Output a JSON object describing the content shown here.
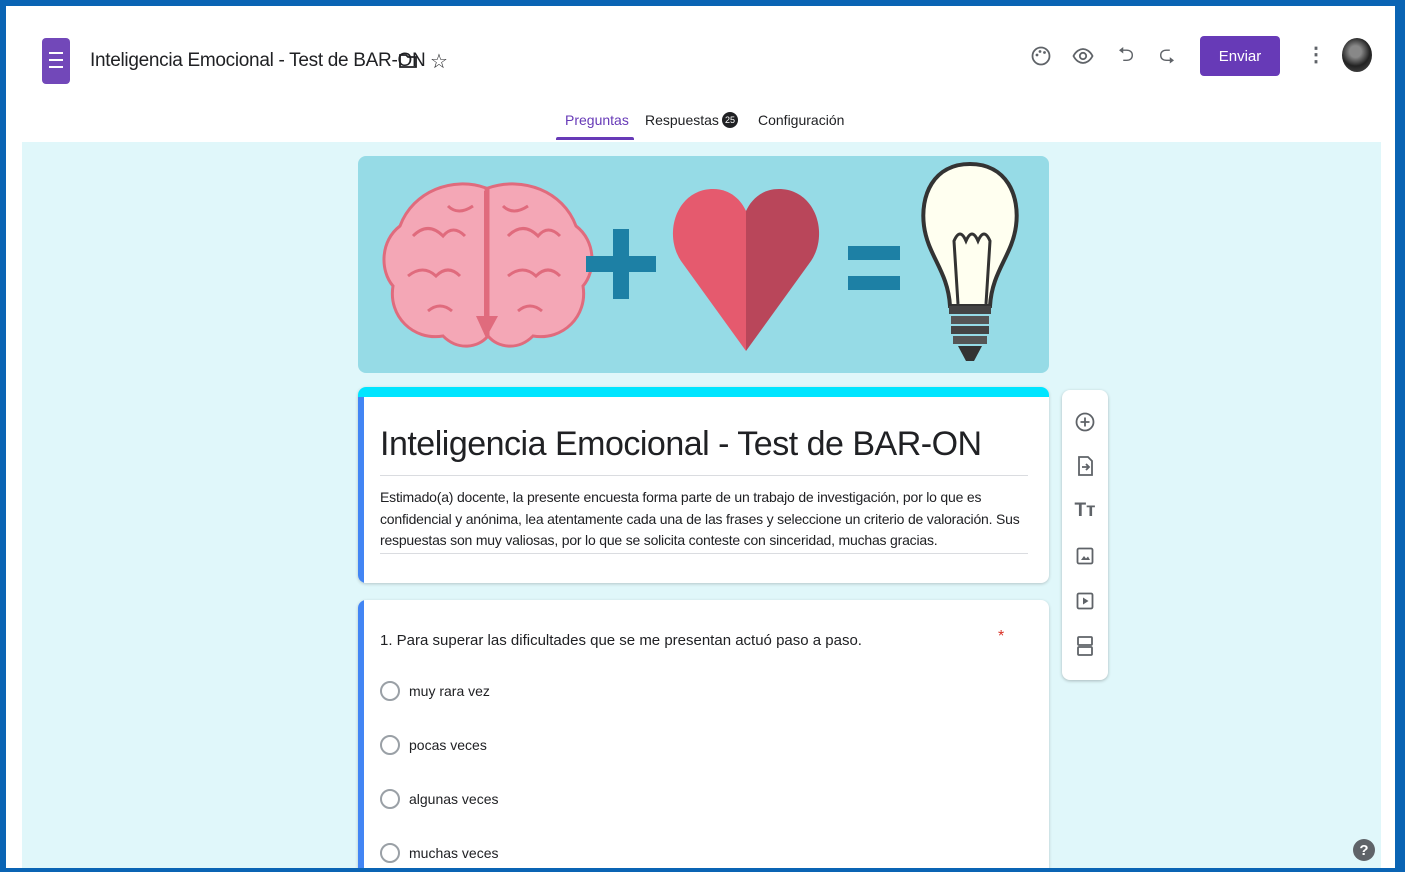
{
  "header": {
    "title": "Inteligencia Emocional - Test de BAR-ON",
    "send_label": "Enviar",
    "icons": [
      "folder-icon",
      "star-icon",
      "palette-icon",
      "preview-icon",
      "undo-icon",
      "redo-icon",
      "more-vert-icon"
    ]
  },
  "tabs": {
    "questions": "Preguntas",
    "responses": "Respuestas",
    "responses_count": "25",
    "settings": "Configuración",
    "active": "Preguntas"
  },
  "form": {
    "title": "Inteligencia Emocional - Test de BAR-ON",
    "description": "Estimado(a) docente, la presente encuesta forma parte de un trabajo de investigación, por lo que es confidencial y anónima, lea atentamente cada una de las frases y seleccione un criterio de valoración. Sus respuestas son muy valiosas, por lo que se solicita conteste con sinceridad, muchas gracias."
  },
  "question1": {
    "text": "1. Para superar las dificultades que se me presentan actuó paso a paso.",
    "required_mark": "*",
    "options": [
      "muy rara vez",
      "pocas veces",
      "algunas veces",
      "muchas veces"
    ]
  },
  "toolbar": {
    "items": [
      "add-question-icon",
      "import-question-icon",
      "add-title-icon",
      "add-image-icon",
      "add-video-icon",
      "add-section-icon"
    ]
  },
  "colors": {
    "accent": "#673ab7",
    "theme": "#00e5ff",
    "background": "#e0f7fa",
    "banner": "#96dbe6",
    "focus_bar": "#4285f4"
  },
  "help_label": "?"
}
